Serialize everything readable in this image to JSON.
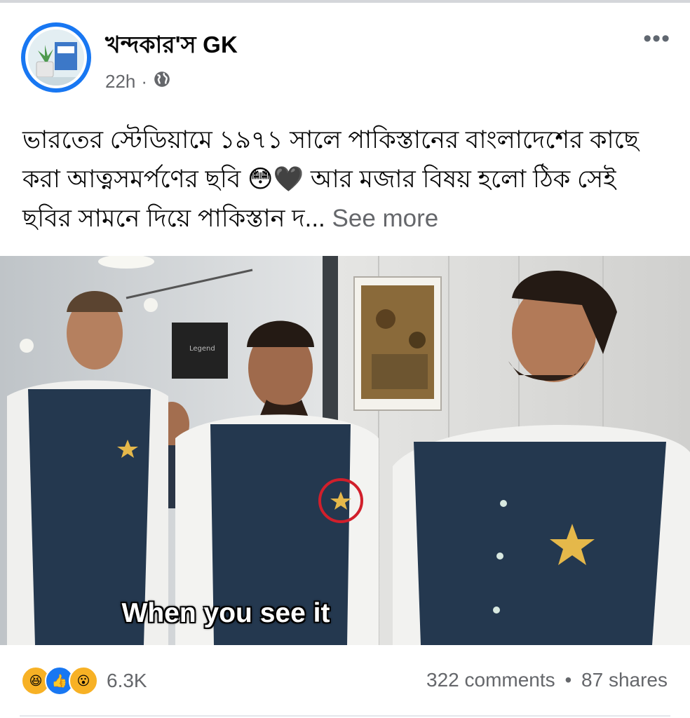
{
  "post": {
    "author": "খন্দকার'স GK",
    "time": "22h",
    "separator": "·",
    "caption": "ভারতের স্টেডিয়ামে ১৯৭১ সালে পাকিস্তানের বাংলাদেশের কাছে করা আত্নসমর্পণের ছবি 😳🖤 আর মজার বিষয় হলো ঠিক সেই ছবির সামনে দিয়ে পাকিস্তান দ...",
    "see_more": "See more",
    "image_overlay_text": "When you see it"
  },
  "reactions": {
    "icons": [
      "haha-icon",
      "like-icon",
      "wow-icon"
    ],
    "count": "6.3K"
  },
  "engagement": {
    "comments": "322 comments",
    "dot": "•",
    "shares": "87 shares"
  },
  "colors": {
    "accent": "#1877f2",
    "secondary_text": "#65676b",
    "vest": "#24384f",
    "star": "#e5b84a"
  }
}
